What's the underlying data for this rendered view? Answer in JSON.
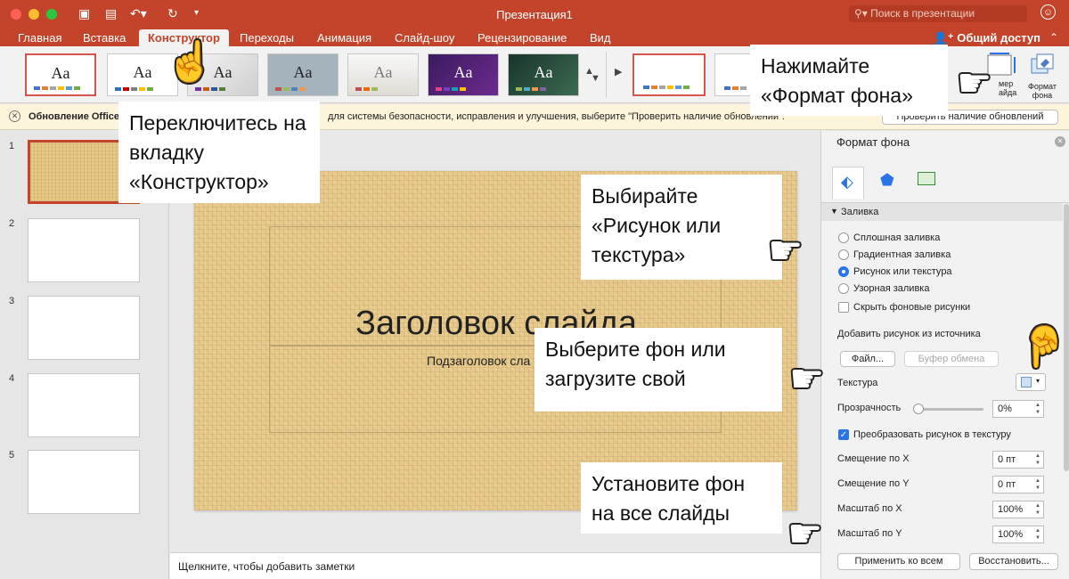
{
  "window": {
    "title": "Презентация1",
    "search_placeholder": "Поиск в презентации",
    "colors": {
      "brand": "#c4442b",
      "accent": "#2a73e8"
    }
  },
  "tabs": [
    "Главная",
    "Вставка",
    "Конструктор",
    "Переходы",
    "Анимация",
    "Слайд-шоу",
    "Рецензирование",
    "Вид"
  ],
  "active_tab": "Конструктор",
  "share_label": "Общий доступ",
  "ribbon": {
    "theme_label": "Aa",
    "size_label_partial": "мер\nайда",
    "format_bg_label": "Формат фона"
  },
  "notification": {
    "title": "Обновление Office",
    "text": "для системы безопасности, исправления и улучшения, выберите \"Проверить наличие обновлений\".",
    "button": "Проверить наличие обновлений"
  },
  "slides": {
    "numbers": [
      "1",
      "2",
      "3",
      "4",
      "5"
    ]
  },
  "slide": {
    "title": "Заголовок слайда",
    "subtitle": "Подзаголовок сла"
  },
  "notes_placeholder": "Щелкните, чтобы добавить заметки",
  "format_pane": {
    "title": "Формат фона",
    "section": "Заливка",
    "fill_options": [
      {
        "label": "Сплошная заливка",
        "selected": false
      },
      {
        "label": "Градиентная заливка",
        "selected": false
      },
      {
        "label": "Рисунок или текстура",
        "selected": true
      },
      {
        "label": "Узорная заливка",
        "selected": false
      }
    ],
    "hide_bg_label": "Скрыть фоновые рисунки",
    "source_label": "Добавить рисунок из источника",
    "file_button": "Файл...",
    "clipboard_button": "Буфер обмена",
    "texture_label": "Текстура",
    "transparency_label": "Прозрачность",
    "transparency_value": "0%",
    "tile_label": "Преобразовать рисунок в текстуру",
    "tile_checked": true,
    "offset_x_label": "Смещение по X",
    "offset_x_value": "0 пт",
    "offset_y_label": "Смещение по Y",
    "offset_y_value": "0 пт",
    "scale_x_label": "Масштаб по X",
    "scale_x_value": "100%",
    "scale_y_label": "Масштаб по Y",
    "scale_y_value": "100%",
    "apply_all_button": "Применить ко всем",
    "reset_button": "Восстановить..."
  },
  "callouts": {
    "switch_tab": "Переключитесь на вкладку «Конструктор»",
    "format_bg": "Нажимайте «Формат фона»",
    "picture_texture": "Выбирайте «Рисунок или текстура»",
    "choose_bg": "Выберите фон или загрузите свой",
    "apply_all": "Установите фон на все слайды"
  }
}
